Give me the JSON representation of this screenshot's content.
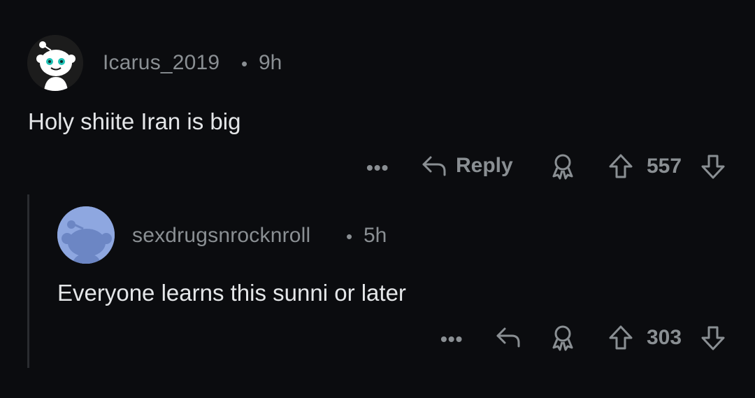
{
  "comments": [
    {
      "username": "Icarus_2019",
      "separator": "•",
      "time": "9h",
      "body": "Holy shiite Iran is big",
      "actions": {
        "more": "•••",
        "reply_label": "Reply",
        "score": "557"
      }
    },
    {
      "username": "sexdrugsnrocknroll",
      "separator": "•",
      "time": "5h",
      "body": "Everyone learns this sunni or later",
      "actions": {
        "more": "•••",
        "score": "303"
      }
    }
  ],
  "icons": {
    "avatar_1": "snoo-avatar-icon",
    "avatar_2": "default-snoo-avatar-icon",
    "reply": "reply-arrow-icon",
    "award": "award-icon",
    "upvote": "upvote-arrow-icon",
    "downvote": "downvote-arrow-icon"
  },
  "colors": {
    "background": "#0b0c0f",
    "muted_text": "#8a8f93",
    "body_text": "#e4e6e8",
    "avatar_2_bg": "#8ea7e0",
    "thread_line": "#2a2c30"
  }
}
